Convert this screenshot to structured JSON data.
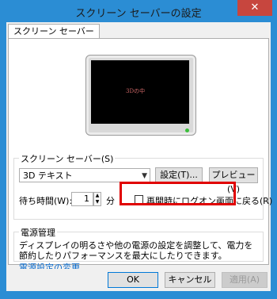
{
  "window": {
    "title": "スクリーン セーバーの設定",
    "close_glyph": "✕"
  },
  "tab": {
    "label": "スクリーン セーバー"
  },
  "preview": {
    "screen_text": "3Dの中"
  },
  "screensaver": {
    "group_label": "スクリーン セーバー(S)",
    "selected": "3D テキスト",
    "settings_label": "設定(T)...",
    "preview_label": "プレビュー(V)",
    "wait_label": "待ち時間(W):",
    "wait_value": "1",
    "wait_unit": "分",
    "resume_label": "再開時にログオン画面に戻る(R)"
  },
  "power": {
    "group_label": "電源管理",
    "description": "ディスプレイの明るさや他の電源の設定を調整して、電力を節約したりパフォーマンスを最大にしたりできます。",
    "link": "電源設定の変更"
  },
  "buttons": {
    "ok": "OK",
    "cancel": "キャンセル",
    "apply": "適用(A)"
  },
  "colors": {
    "titlebar": "#2b8dd4",
    "highlight": "#e00000",
    "link": "#0066cc"
  }
}
